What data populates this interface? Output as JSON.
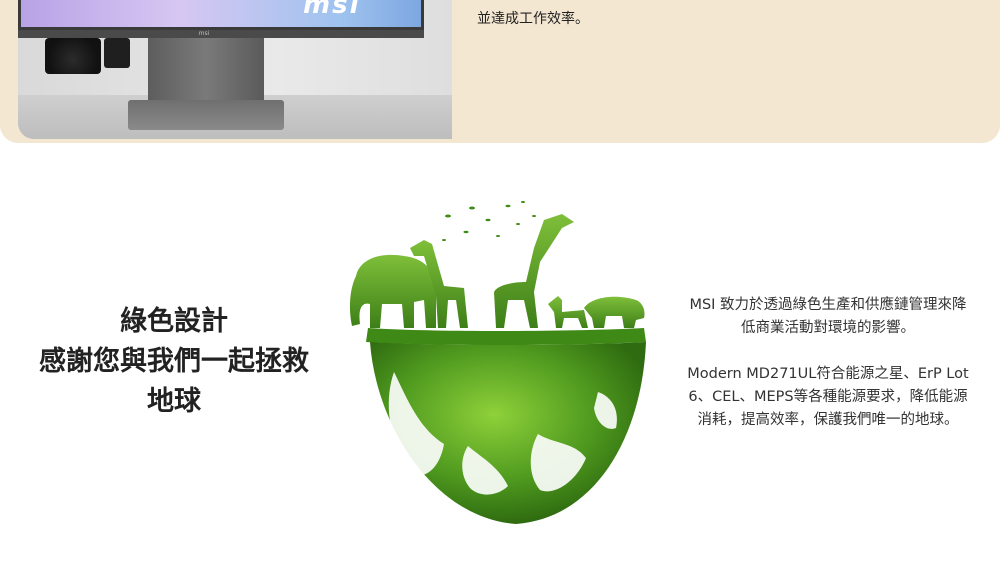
{
  "top": {
    "screen_logo": "msi",
    "bezel_logo": "msi",
    "caption": "並達成工作效率。"
  },
  "green": {
    "title_lines": [
      "綠色設計",
      "感謝您與我們一起拯救",
      "地球"
    ],
    "para1_lines": [
      "MSI 致力於透過綠色生產和供應鏈管理來降",
      "低商業活動對環境的影響。"
    ],
    "para2_lines": [
      "Modern MD271UL符合能源之星、ErP Lot",
      "6、CEL、MEPS等各種能源要求，降低能源",
      "消耗，提高效率，保護我們唯一的地球。"
    ]
  },
  "colors": {
    "band": "#f4e7d2",
    "foliage": "#4f9a1f",
    "text": "#222222"
  }
}
